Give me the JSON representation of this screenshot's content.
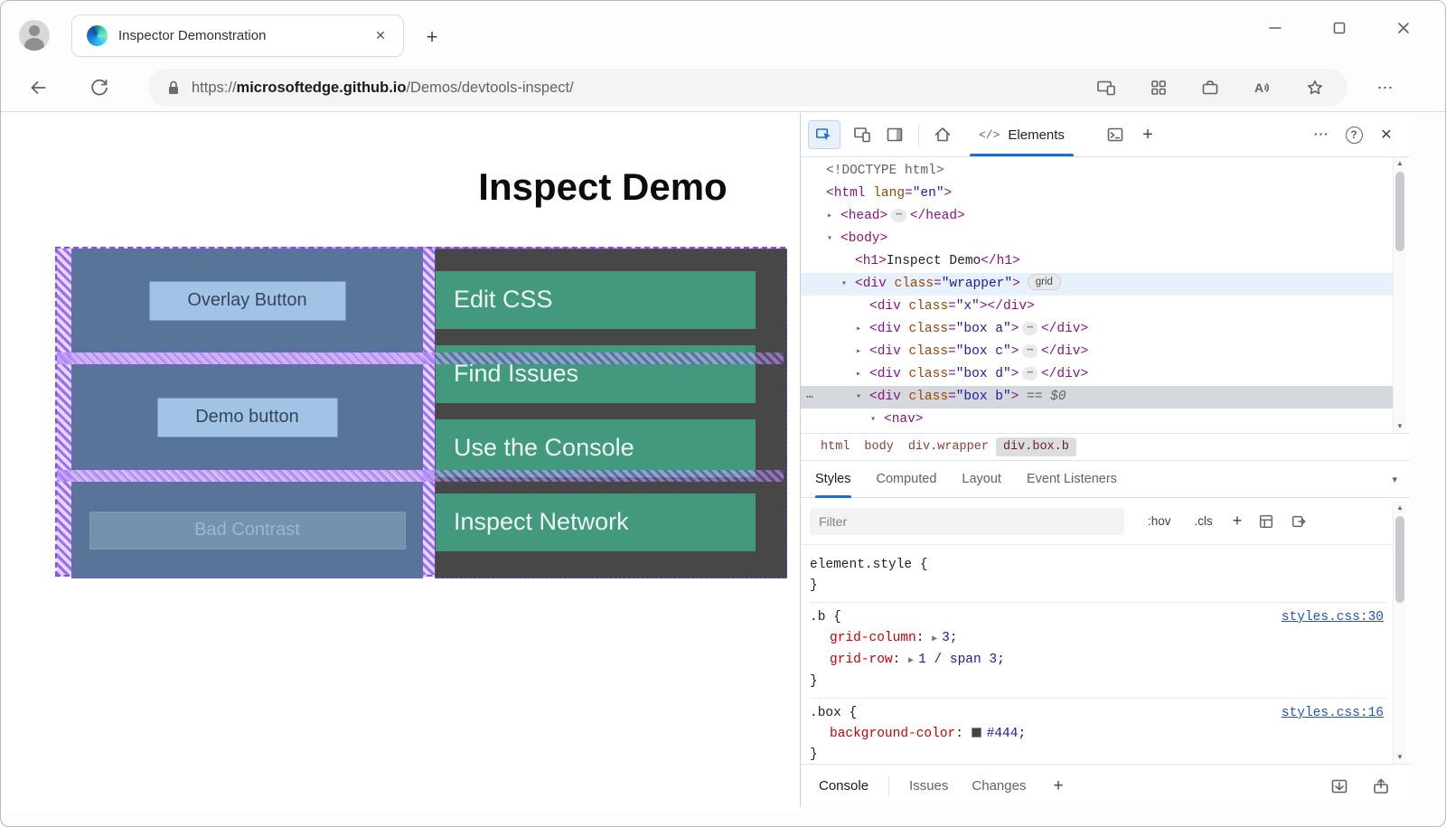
{
  "browser": {
    "tab": {
      "title": "Inspector Demonstration",
      "close": "✕"
    },
    "new_tab": "+",
    "url": {
      "scheme": "https://",
      "domain": "microsoftedge.github.io",
      "path": "/Demos/devtools-inspect/"
    }
  },
  "page": {
    "heading": "Inspect Demo",
    "buttons": [
      {
        "label": "Overlay Button"
      },
      {
        "label": "Demo button"
      },
      {
        "label": "Bad Contrast"
      }
    ],
    "nav_links": [
      "Edit CSS",
      "Find Issues",
      "Use the Console",
      "Inspect Network"
    ],
    "colors": {
      "box_blue": "#587499",
      "box_dark": "#474747",
      "teal": "#43997d",
      "overlay_purple": "#8a4cf0"
    }
  },
  "devtools": {
    "toolbar": {
      "tab_icon": "</>",
      "tab_label": "Elements",
      "more": "⋯",
      "help": "?",
      "close": "✕",
      "plus": "+"
    },
    "dom_lines": [
      {
        "indent": 28,
        "tokens": [
          {
            "c": "g",
            "t": "<!DOCTYPE html>"
          }
        ]
      },
      {
        "indent": 28,
        "tokens": [
          {
            "c": "t",
            "t": "<html "
          },
          {
            "c": "a",
            "t": "lang"
          },
          {
            "c": "t",
            "t": "="
          },
          {
            "c": "v",
            "t": "\"en\""
          },
          {
            "c": "t",
            "t": ">"
          }
        ]
      },
      {
        "indent": 44,
        "arrow": "right",
        "tokens": [
          {
            "c": "t",
            "t": "<head>"
          },
          {
            "c": "d",
            "t": "⋯"
          },
          {
            "c": "t",
            "t": "</head>"
          }
        ]
      },
      {
        "indent": 44,
        "arrow": "down",
        "tokens": [
          {
            "c": "t",
            "t": "<body>"
          }
        ]
      },
      {
        "indent": 60,
        "tokens": [
          {
            "c": "t",
            "t": "<h1>"
          },
          {
            "c": "x",
            "t": "Inspect Demo"
          },
          {
            "c": "t",
            "t": "</h1>"
          }
        ]
      },
      {
        "indent": 60,
        "arrow": "down",
        "hl": "hover",
        "tokens": [
          {
            "c": "t",
            "t": "<div "
          },
          {
            "c": "a",
            "t": "class"
          },
          {
            "c": "t",
            "t": "="
          },
          {
            "c": "v",
            "t": "\"wrapper\""
          },
          {
            "c": "t",
            "t": ">"
          },
          {
            "c": "b",
            "t": "grid"
          }
        ]
      },
      {
        "indent": 76,
        "tokens": [
          {
            "c": "t",
            "t": "<div "
          },
          {
            "c": "a",
            "t": "class"
          },
          {
            "c": "t",
            "t": "="
          },
          {
            "c": "v",
            "t": "\"x\""
          },
          {
            "c": "t",
            "t": ">"
          },
          {
            "c": "t",
            "t": "</div>"
          }
        ]
      },
      {
        "indent": 76,
        "arrow": "right",
        "tokens": [
          {
            "c": "t",
            "t": "<div "
          },
          {
            "c": "a",
            "t": "class"
          },
          {
            "c": "t",
            "t": "="
          },
          {
            "c": "v",
            "t": "\"box a\""
          },
          {
            "c": "t",
            "t": ">"
          },
          {
            "c": "d",
            "t": "⋯"
          },
          {
            "c": "t",
            "t": "</div>"
          }
        ]
      },
      {
        "indent": 76,
        "arrow": "right",
        "tokens": [
          {
            "c": "t",
            "t": "<div "
          },
          {
            "c": "a",
            "t": "class"
          },
          {
            "c": "t",
            "t": "="
          },
          {
            "c": "v",
            "t": "\"box c\""
          },
          {
            "c": "t",
            "t": ">"
          },
          {
            "c": "d",
            "t": "⋯"
          },
          {
            "c": "t",
            "t": "</div>"
          }
        ]
      },
      {
        "indent": 76,
        "arrow": "right",
        "tokens": [
          {
            "c": "t",
            "t": "<div "
          },
          {
            "c": "a",
            "t": "class"
          },
          {
            "c": "t",
            "t": "="
          },
          {
            "c": "v",
            "t": "\"box d\""
          },
          {
            "c": "t",
            "t": ">"
          },
          {
            "c": "d",
            "t": "⋯"
          },
          {
            "c": "t",
            "t": "</div>"
          }
        ]
      },
      {
        "indent": 76,
        "arrow": "down",
        "hl": "selected",
        "gutter": "⋯",
        "tokens": [
          {
            "c": "t",
            "t": "<div "
          },
          {
            "c": "a",
            "t": "class"
          },
          {
            "c": "t",
            "t": "="
          },
          {
            "c": "v",
            "t": "\"box b\""
          },
          {
            "c": "t",
            "t": ">"
          },
          {
            "c": "e",
            "t": " == $0"
          }
        ]
      },
      {
        "indent": 92,
        "arrow": "down",
        "tokens": [
          {
            "c": "t",
            "t": "<nav>"
          }
        ]
      }
    ],
    "crumbs": [
      {
        "label": "html"
      },
      {
        "label": "body"
      },
      {
        "label": "div.wrapper"
      },
      {
        "label": "div.box.b",
        "selected": true
      }
    ],
    "style_tabs": [
      {
        "label": "Styles",
        "active": true
      },
      {
        "label": "Computed"
      },
      {
        "label": "Layout"
      },
      {
        "label": "Event Listeners"
      }
    ],
    "filter": {
      "placeholder": "Filter",
      "hov": ":hov",
      "cls": ".cls",
      "plus": "+"
    },
    "rules": [
      {
        "selector": "element.style",
        "props": []
      },
      {
        "selector": ".b",
        "link": "styles.css:30",
        "props": [
          {
            "name": "grid-column",
            "arrow": true,
            "value": "3"
          },
          {
            "name": "grid-row",
            "arrow": true,
            "value": "1 / span 3"
          }
        ]
      },
      {
        "selector": ".box",
        "link": "styles.css:16",
        "props": [
          {
            "name": "background-color",
            "swatch": "#444",
            "value": "#444"
          }
        ]
      }
    ],
    "drawer_tabs": [
      {
        "label": "Console",
        "active": true
      },
      {
        "label": "Issues"
      },
      {
        "label": "Changes"
      }
    ],
    "drawer_plus": "+"
  }
}
